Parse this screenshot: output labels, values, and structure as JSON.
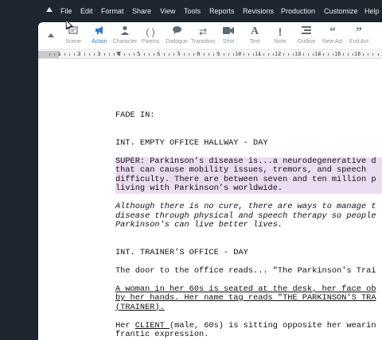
{
  "menu": {
    "items": [
      "File",
      "Edit",
      "Format",
      "Share",
      "View",
      "Tools",
      "Reports",
      "Revisions",
      "Production",
      "Customize",
      "Help"
    ]
  },
  "toolbar": {
    "tools": [
      {
        "label": "Scene",
        "icon": "scene-icon"
      },
      {
        "label": "Action",
        "icon": "megaphone-icon"
      },
      {
        "label": "Character",
        "icon": "person-icon"
      },
      {
        "label": "Parens",
        "icon": "parens-icon"
      },
      {
        "label": "Dialogue",
        "icon": "speech-bubble-icon"
      },
      {
        "label": "Transition",
        "icon": "swap-arrows-icon"
      },
      {
        "label": "Shot",
        "icon": "camera-icon"
      },
      {
        "label": "Text",
        "icon": "text-icon"
      },
      {
        "label": "Note",
        "icon": "exclamation-icon"
      },
      {
        "label": "Outline",
        "icon": "outline-list-icon"
      },
      {
        "label": "New Act",
        "icon": "quote-icon"
      },
      {
        "label": "End Act",
        "icon": "quote-close-icon"
      }
    ],
    "active": "Action",
    "accent": "#2f7bd1"
  },
  "ruler": {
    "numbers": [
      "1",
      "2",
      "3",
      "4",
      "5",
      "6",
      "7",
      "8",
      "9",
      "10",
      "11",
      "12",
      "13",
      "14",
      "15",
      "16"
    ]
  },
  "script": {
    "fade_in": "FADE IN:",
    "scene1": "INT. EMPTY OFFICE HALLWAY - DAY",
    "super_text": "SUPER: Parkinson’s disease is...a neurodegenerative d\nthat can cause mobility issues, tremors, and speech\ndifficulty. There are between seven and ten million p\nliving with Parkinson’s worldwide.",
    "italic_text": "Although there is no cure, there are ways to manage t\ndisease through physical and speech therapy so people\nParkinson's can live better lives.",
    "scene2": "INT. TRAINER'S OFFICE - DAY",
    "door_text": "The door to the office reads... \"The Parkinson's Trai",
    "woman_text": "A woman in her 60s is seated at the desk, her face ob\nby her hands. Her name tag reads \"THE PARKINSON'S TRA\n(TRAINER).",
    "client_pre": "Her ",
    "client_word": "CLIENT ",
    "client_post": "(male, 60s) is sitting opposite her wearin\nfrantic expression.",
    "highlight_color": "#ecdcf1"
  }
}
